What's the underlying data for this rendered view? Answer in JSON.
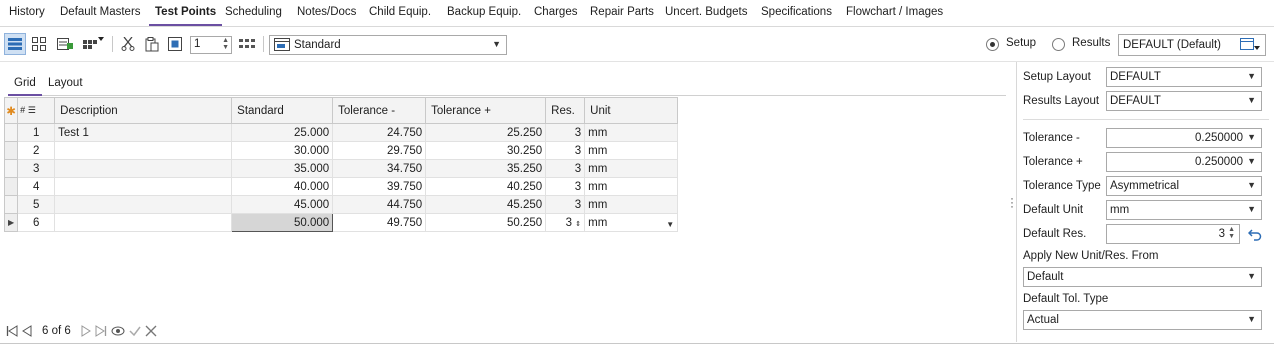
{
  "tabs": [
    {
      "label": "History"
    },
    {
      "label": "Default Masters"
    },
    {
      "label": "Test Points",
      "active": true
    },
    {
      "label": "Scheduling"
    },
    {
      "label": "Notes/Docs"
    },
    {
      "label": "Child Equip."
    },
    {
      "label": "Backup Equip."
    },
    {
      "label": "Charges"
    },
    {
      "label": "Repair Parts"
    },
    {
      "label": "Uncert. Budgets"
    },
    {
      "label": "Specifications"
    },
    {
      "label": "Flowchart / Images"
    }
  ],
  "toolbar": {
    "spin_value": "1",
    "view_combo": "Standard",
    "radio_setup": "Setup",
    "radio_results": "Results",
    "selected_mode": "Setup",
    "layout_combo": "DEFAULT (Default)"
  },
  "subtabs": [
    {
      "label": "Grid",
      "active": true
    },
    {
      "label": "Layout"
    }
  ],
  "grid": {
    "headers": {
      "num": "#",
      "description": "Description",
      "standard": "Standard",
      "tol_minus": "Tolerance -",
      "tol_plus": "Tolerance +",
      "res": "Res.",
      "unit": "Unit"
    },
    "rows": [
      {
        "num": "1",
        "description": "Test 1",
        "standard": "25.000",
        "tol_minus": "24.750",
        "tol_plus": "25.250",
        "res": "3",
        "unit": "mm"
      },
      {
        "num": "2",
        "description": "",
        "standard": "30.000",
        "tol_minus": "29.750",
        "tol_plus": "30.250",
        "res": "3",
        "unit": "mm"
      },
      {
        "num": "3",
        "description": "",
        "standard": "35.000",
        "tol_minus": "34.750",
        "tol_plus": "35.250",
        "res": "3",
        "unit": "mm"
      },
      {
        "num": "4",
        "description": "",
        "standard": "40.000",
        "tol_minus": "39.750",
        "tol_plus": "40.250",
        "res": "3",
        "unit": "mm"
      },
      {
        "num": "5",
        "description": "",
        "standard": "45.000",
        "tol_minus": "44.750",
        "tol_plus": "45.250",
        "res": "3",
        "unit": "mm"
      },
      {
        "num": "6",
        "description": "",
        "standard": "50.000",
        "tol_minus": "49.750",
        "tol_plus": "50.250",
        "res": "3",
        "unit": "mm"
      }
    ]
  },
  "pager": {
    "count": "6 of 6"
  },
  "panel": {
    "setup_layout_label": "Setup Layout",
    "setup_layout_value": "DEFAULT",
    "results_layout_label": "Results Layout",
    "results_layout_value": "DEFAULT",
    "tol_minus_label": "Tolerance -",
    "tol_minus_value": "0.250000",
    "tol_plus_label": "Tolerance +",
    "tol_plus_value": "0.250000",
    "tol_type_label": "Tolerance Type",
    "tol_type_value": "Asymmetrical",
    "default_unit_label": "Default Unit",
    "default_unit_value": "mm",
    "default_res_label": "Default Res.",
    "default_res_value": "3",
    "apply_from_label": "Apply New Unit/Res. From",
    "apply_from_value": "Default",
    "default_tol_type_label": "Default Tol. Type",
    "default_tol_type_value": "Actual"
  },
  "colors": {
    "active_tab_underline": "#6b4fa2",
    "selected_tool": "#cfe0f3",
    "accent_blue": "#2d6db5",
    "new_row_star": "#e08a1e"
  },
  "icons": [
    "grid-view-icon",
    "card-view-icon",
    "add-record-icon",
    "columns-icon",
    "cut-icon",
    "paste-icon",
    "select-icon",
    "density-icon",
    "view-icon",
    "layout-icon",
    "undo-icon",
    "first-icon",
    "prev-icon",
    "next-icon",
    "last-icon",
    "view-eye-icon",
    "check-icon",
    "close-icon"
  ]
}
